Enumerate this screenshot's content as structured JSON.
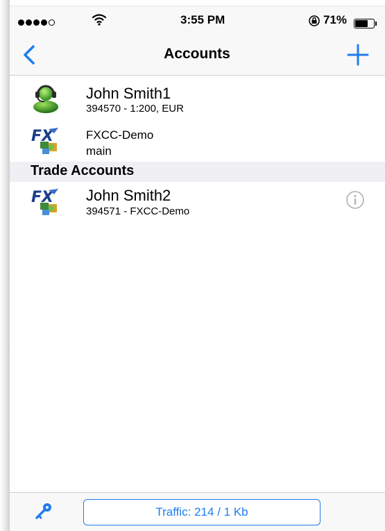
{
  "status_bar": {
    "time": "3:55 PM",
    "battery_percent": "71%",
    "battery_level": 0.71,
    "signal_bars_filled": 4,
    "signal_bars_total": 5
  },
  "nav": {
    "title": "Accounts",
    "back_icon": "chevron-left-icon",
    "add_icon": "plus-icon"
  },
  "accounts": [
    {
      "name": "John Smith1",
      "detail": "394570 - 1:200, EUR",
      "icon": "user-avatar-icon"
    },
    {
      "name": "FXCC-Demo",
      "detail": "main",
      "icon": "broker-fx-icon"
    }
  ],
  "trade_section": {
    "label": "Trade Accounts",
    "items": [
      {
        "name": "John Smith2",
        "detail": "394571 - FXCC-Demo",
        "icon": "broker-fx-icon",
        "info_icon": "info-icon"
      }
    ]
  },
  "toolbar": {
    "traffic_label": "Traffic: 214 / 1 Kb",
    "key_icon": "key-icon"
  },
  "colors": {
    "accent": "#1e7cf0",
    "bar_background": "#f8f8f8",
    "section_background": "#efeff4",
    "info_gray": "#b0b0b0"
  }
}
